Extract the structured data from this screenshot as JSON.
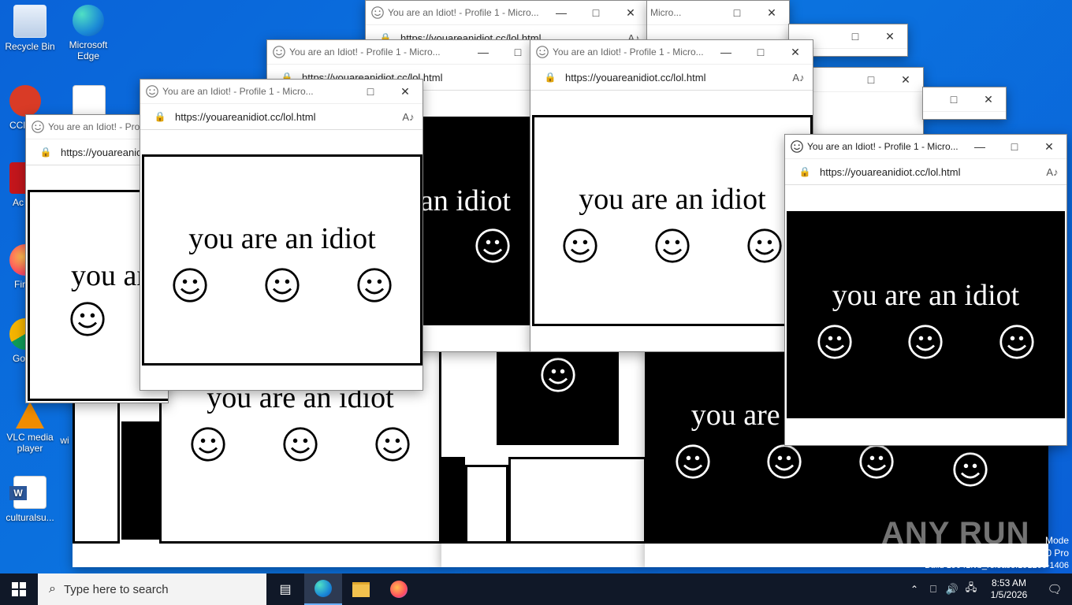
{
  "desktop": {
    "icons": [
      {
        "label": "Recycle Bin",
        "icon": "recycle-bin-icon"
      },
      {
        "label": "Microsoft Edge",
        "icon": "edge-icon"
      },
      {
        "label": "CCl",
        "icon": "ccleaner-icon"
      },
      {
        "label": "Ac Ac",
        "icon": "acrobat-icon"
      },
      {
        "label": "Fir",
        "icon": "firefox-icon"
      },
      {
        "label": "Go Chr",
        "icon": "chrome-icon"
      },
      {
        "label": "VLC media player",
        "icon": "vlc-icon"
      },
      {
        "label": "wi",
        "icon": "file-icon"
      },
      {
        "label": "culturalsu...",
        "icon": "word-doc-icon"
      }
    ],
    "watermark": "ANY RUN",
    "sysinfo": [
      "Mode",
      "0 Pro",
      "Build 19041.vb_release.191206-1406"
    ]
  },
  "browser_window": {
    "title": "You are an Idiot! - Profile 1 - Micro...",
    "url": "https://youareanidiot.cc/lol.html",
    "read_aloud": "A♪",
    "lock": "🔒",
    "minimize": "—",
    "maximize": "□",
    "close": "✕"
  },
  "page_text": "you are an idiot",
  "taskbar": {
    "start_icon": "windows-icon",
    "search_placeholder": "Type here to search",
    "time": "8:53 AM",
    "date": "1/5/2026",
    "pinned": [
      "task-view-icon",
      "edge-icon",
      "file-explorer-icon",
      "firefox-icon"
    ]
  }
}
